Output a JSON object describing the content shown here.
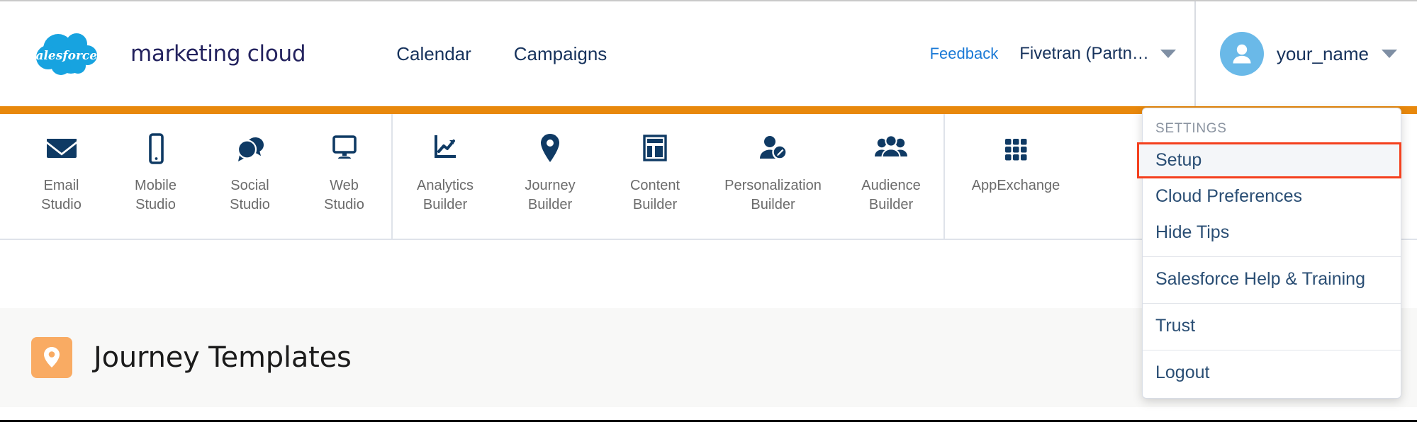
{
  "brand": {
    "logo_text": "salesforce",
    "product_name": "marketing cloud",
    "logo_icon": "salesforce-cloud-logo"
  },
  "header": {
    "nav_links": [
      {
        "label": "Calendar",
        "icon": "calendar-link"
      },
      {
        "label": "Campaigns",
        "icon": "campaigns-link"
      }
    ],
    "feedback_label": "Feedback",
    "org_selector": {
      "value": "Fivetran (Partn…",
      "caret_icon": "chevron-down-icon"
    },
    "user": {
      "name": "your_name",
      "avatar_icon": "user-avatar-icon",
      "caret_icon": "chevron-down-icon"
    }
  },
  "accent_colors": {
    "orange_rule": "#e8880c",
    "highlight_border": "#f4401e",
    "link_blue": "#1b7ad6",
    "nav_navy": "#16325c",
    "icon_navy": "#0f3a64",
    "avatar_blue": "#6ab9e8",
    "page_icon_orange": "#f9ab63"
  },
  "app_nav": {
    "studios": [
      {
        "label": "Email\nStudio",
        "icon": "envelope-icon"
      },
      {
        "label": "Mobile\nStudio",
        "icon": "mobile-phone-icon"
      },
      {
        "label": "Social\nStudio",
        "icon": "speech-bubbles-icon"
      },
      {
        "label": "Web\nStudio",
        "icon": "monitor-icon"
      }
    ],
    "builders": [
      {
        "label": "Analytics\nBuilder",
        "icon": "line-chart-icon"
      },
      {
        "label": "Journey\nBuilder",
        "icon": "map-pin-icon"
      },
      {
        "label": "Content\nBuilder",
        "icon": "layout-grid-icon"
      },
      {
        "label": "Personalization\nBuilder",
        "icon": "person-pencil-icon"
      },
      {
        "label": "Audience\nBuilder",
        "icon": "people-group-icon"
      }
    ],
    "extras": [
      {
        "label": "AppExchange",
        "icon": "app-grid-icon"
      }
    ]
  },
  "user_menu": {
    "sections": [
      {
        "heading": "SETTINGS",
        "items": [
          {
            "label": "Setup",
            "highlighted": true
          },
          {
            "label": "Cloud Preferences",
            "highlighted": false
          },
          {
            "label": "Hide Tips",
            "highlighted": false
          }
        ]
      },
      {
        "heading": "",
        "items": [
          {
            "label": "Salesforce Help & Training",
            "highlighted": false
          }
        ]
      },
      {
        "heading": "",
        "items": [
          {
            "label": "Trust",
            "highlighted": false
          }
        ]
      },
      {
        "heading": "",
        "items": [
          {
            "label": "Logout",
            "highlighted": false
          }
        ]
      }
    ]
  },
  "page": {
    "title": "Journey Templates",
    "icon": "journey-map-pin-icon"
  }
}
